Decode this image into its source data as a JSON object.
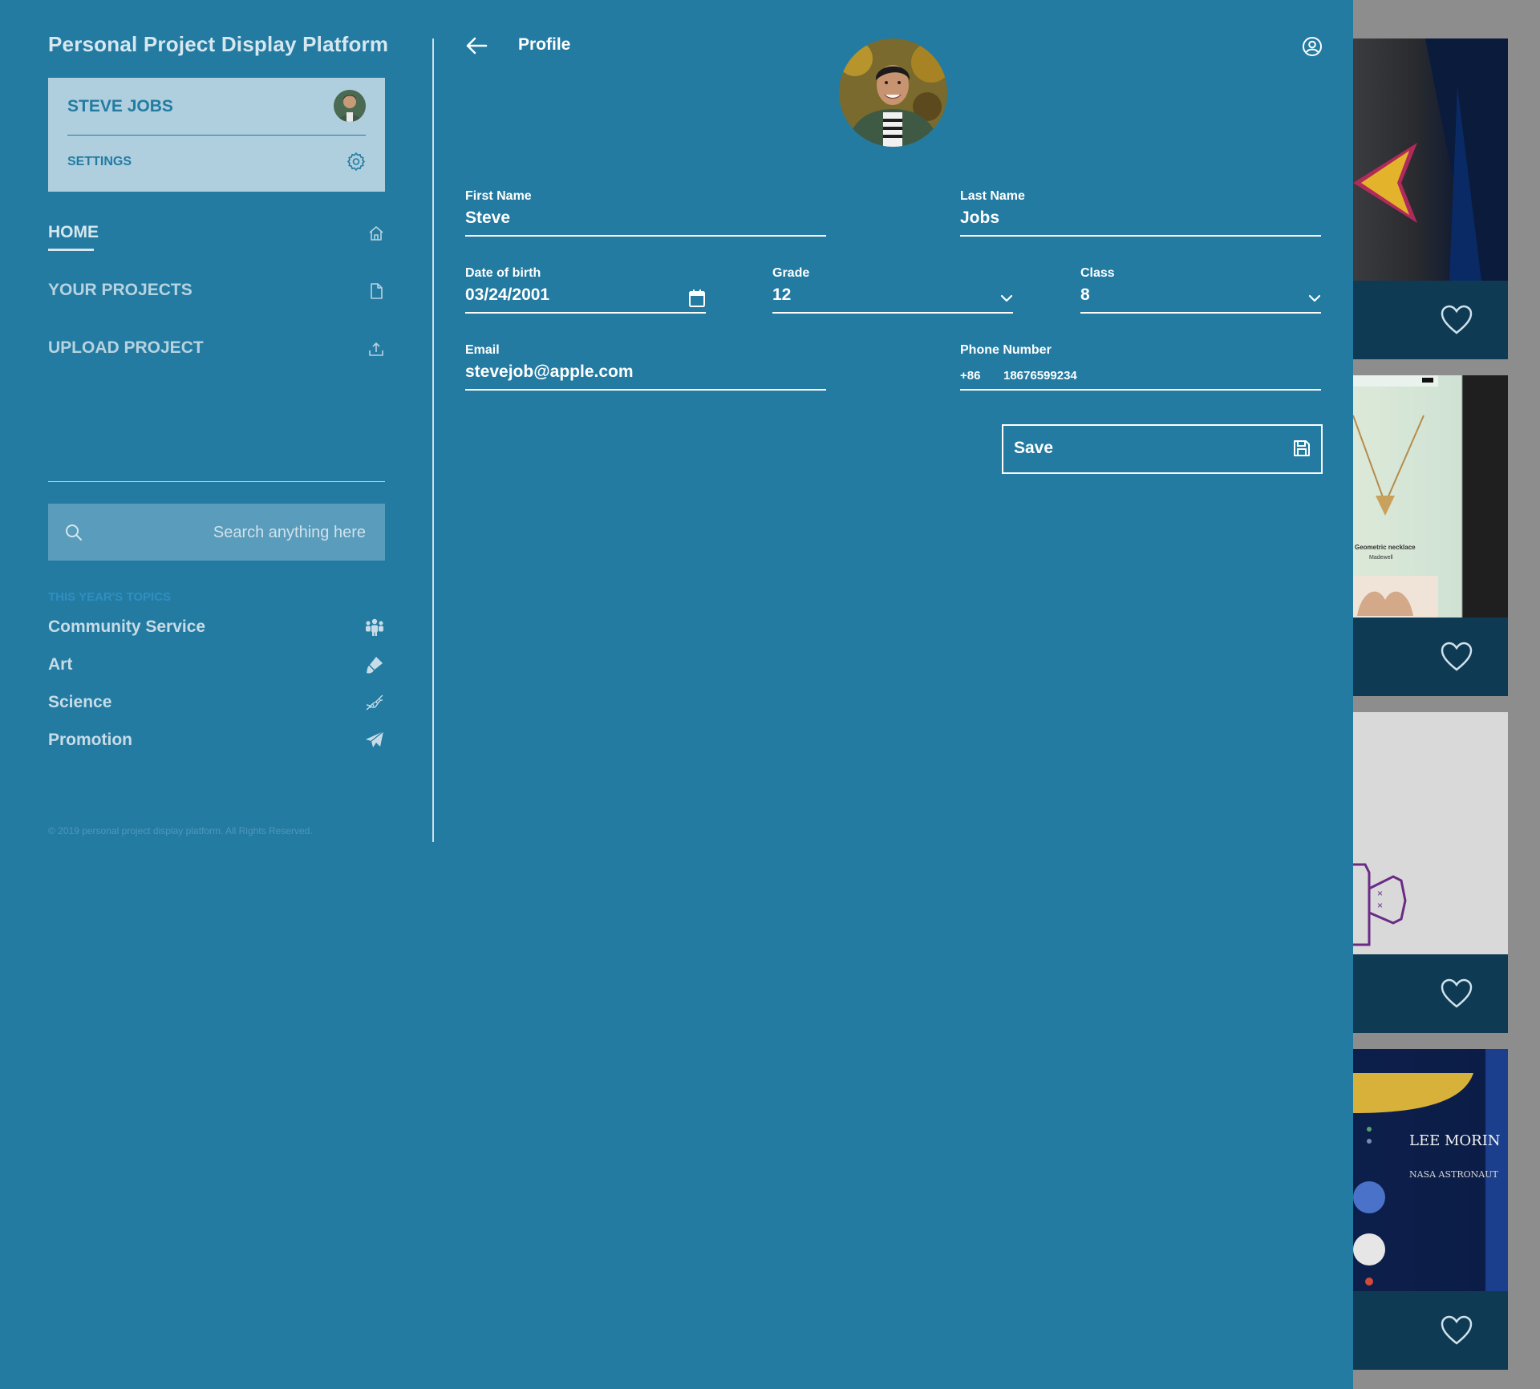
{
  "app": {
    "title": "Personal Project Display Platform"
  },
  "user": {
    "name": "STEVE JOBS",
    "settings_label": "SETTINGS"
  },
  "nav": {
    "home": "HOME",
    "projects": "YOUR PROJECTS",
    "upload": "UPLOAD PROJECT"
  },
  "search": {
    "placeholder": "Search anything here"
  },
  "topics": {
    "heading": "THIS YEAR'S TOPICS",
    "items": [
      {
        "label": "Community Service",
        "icon": "people-icon"
      },
      {
        "label": "Art",
        "icon": "paint-brush-icon"
      },
      {
        "label": "Science",
        "icon": "dna-icon"
      },
      {
        "label": "Promotion",
        "icon": "paper-plane-icon"
      }
    ]
  },
  "footer": {
    "copyright": "© 2019 personal project display platform. All Rights Reserved."
  },
  "profile": {
    "title": "Profile",
    "first_name": {
      "label": "First Name",
      "value": "Steve"
    },
    "last_name": {
      "label": "Last Name",
      "value": "Jobs"
    },
    "dob": {
      "label": "Date of birth",
      "value": "03/24/2001"
    },
    "grade": {
      "label": "Grade",
      "value": "12"
    },
    "class": {
      "label": "Class",
      "value": "8"
    },
    "email": {
      "label": "Email",
      "value": "stevejob@apple.com"
    },
    "phone": {
      "label": "Phone Number",
      "code": "+86",
      "value": "18676599234"
    },
    "save_label": "Save"
  },
  "background_cards": {
    "card2_caption": "Geometric necklace",
    "card2_sub": "Madewell",
    "card4_title": "LEE MORIN",
    "card4_sub": "NASA ASTRONAUT"
  },
  "colors": {
    "panel": "#237ba2",
    "user_card": "#afcfde",
    "search_box": "#5a9cbb",
    "card_footer": "#0e3b53"
  }
}
